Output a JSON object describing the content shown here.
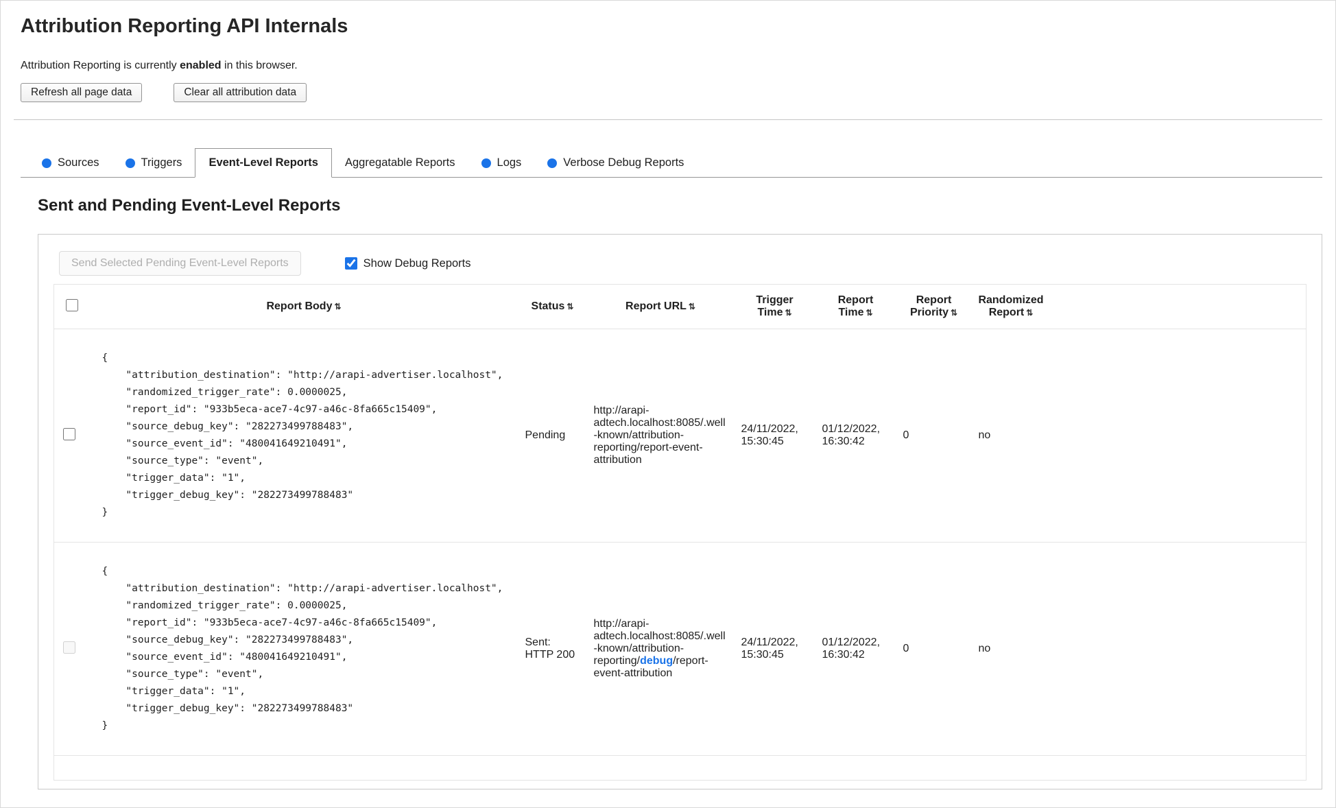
{
  "colors": {
    "accent_blue": "#1a73e8",
    "debug_link_blue": "#1a73e8"
  },
  "icons": {
    "sort": "⇅",
    "tab_status_dot": "blue-circle"
  },
  "page": {
    "title": "Attribution Reporting API Internals",
    "status_prefix": "Attribution Reporting is currently ",
    "status_bold": "enabled",
    "status_suffix": " in this browser.",
    "refresh_button": "Refresh all page data",
    "clear_button": "Clear all attribution data"
  },
  "tabs": [
    {
      "label": "Sources",
      "dot": true,
      "active": false
    },
    {
      "label": "Triggers",
      "dot": true,
      "active": false
    },
    {
      "label": "Event-Level Reports",
      "dot": false,
      "active": true
    },
    {
      "label": "Aggregatable Reports",
      "dot": false,
      "active": false
    },
    {
      "label": "Logs",
      "dot": true,
      "active": false
    },
    {
      "label": "Verbose Debug Reports",
      "dot": true,
      "active": false
    }
  ],
  "section": {
    "heading": "Sent and Pending Event-Level Reports",
    "send_button": "Send Selected Pending Event-Level Reports",
    "show_debug_label": "Show Debug Reports",
    "show_debug_checked": true
  },
  "table": {
    "headers": [
      "Report Body",
      "Status",
      "Report URL",
      "Trigger Time",
      "Report Time",
      "Report Priority",
      "Randomized Report"
    ],
    "select_all_checked": false,
    "rows": [
      {
        "checked": false,
        "checkbox_disabled": false,
        "body": "{\n    \"attribution_destination\": \"http://arapi-advertiser.localhost\",\n    \"randomized_trigger_rate\": 0.0000025,\n    \"report_id\": \"933b5eca-ace7-4c97-a46c-8fa665c15409\",\n    \"source_debug_key\": \"282273499788483\",\n    \"source_event_id\": \"480041649210491\",\n    \"source_type\": \"event\",\n    \"trigger_data\": \"1\",\n    \"trigger_debug_key\": \"282273499788483\"\n}",
        "status": "Pending",
        "url_prefix": "http://arapi-adtech.localhost:8085/.well-known/attribution-reporting/report-event-attribution",
        "url_highlight": "",
        "url_suffix": "",
        "trigger_time": "24/11/2022, 15:30:45",
        "report_time": "01/12/2022, 16:30:42",
        "priority": "0",
        "randomized": "no"
      },
      {
        "checked": false,
        "checkbox_disabled": true,
        "body": "{\n    \"attribution_destination\": \"http://arapi-advertiser.localhost\",\n    \"randomized_trigger_rate\": 0.0000025,\n    \"report_id\": \"933b5eca-ace7-4c97-a46c-8fa665c15409\",\n    \"source_debug_key\": \"282273499788483\",\n    \"source_event_id\": \"480041649210491\",\n    \"source_type\": \"event\",\n    \"trigger_data\": \"1\",\n    \"trigger_debug_key\": \"282273499788483\"\n}",
        "status": "Sent: HTTP 200",
        "url_prefix": "http://arapi-adtech.localhost:8085/.well-known/attribution-reporting/",
        "url_highlight": "debug",
        "url_suffix": "/report-event-attribution",
        "trigger_time": "24/11/2022, 15:30:45",
        "report_time": "01/12/2022, 16:30:42",
        "priority": "0",
        "randomized": "no"
      }
    ]
  }
}
